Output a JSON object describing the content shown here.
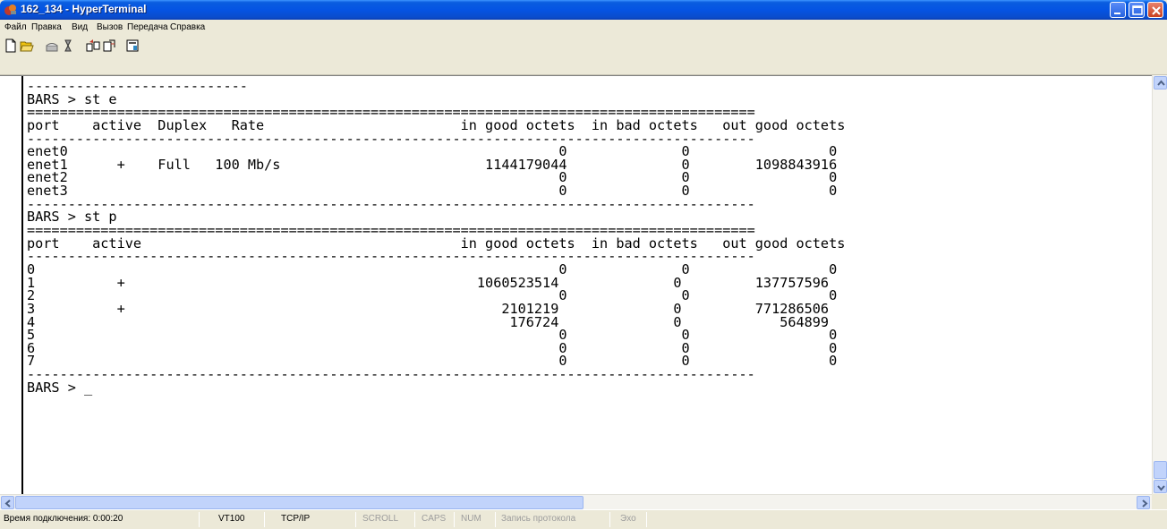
{
  "window": {
    "title": "162_134 - HyperTerminal",
    "colors": {
      "titlebar": "#0554e3",
      "close": "#c8401f"
    }
  },
  "menu": {
    "items": [
      "Файл",
      "Правка",
      "Вид",
      "Вызов",
      "Передача",
      "Справка"
    ]
  },
  "toolbar": {
    "icons": [
      "new-icon",
      "open-icon",
      "call-icon",
      "disconnect-icon",
      "send-icon",
      "receive-icon",
      "properties-icon"
    ]
  },
  "terminal": {
    "lines": [
      "---------------------------",
      "BARS > st e",
      "=========================================================================================",
      "port    active  Duplex   Rate                        in good octets  in bad octets   out good octets",
      "-----------------------------------------------------------------------------------------",
      "enet0                                                            0              0                 0",
      "enet1      +    Full   100 Mb/s                         1144179044              0        1098843916",
      "enet2                                                            0              0                 0",
      "enet3                                                            0              0                 0",
      "-----------------------------------------------------------------------------------------",
      "BARS > st p",
      "=========================================================================================",
      "port    active                                       in good octets  in bad octets   out good octets",
      "-----------------------------------------------------------------------------------------",
      "0                                                                0              0                 0",
      "1          +                                           1060523514              0         137757596",
      "2                                                                0              0                 0",
      "3          +                                              2101219              0         771286506",
      "4                                                          176724              0            564899",
      "5                                                                0              0                 0",
      "6                                                                0              0                 0",
      "7                                                                0              0                 0",
      "-----------------------------------------------------------------------------------------",
      "BARS > _"
    ]
  },
  "status": {
    "connection_time": "Время подключения: 0:00:20",
    "emulation": "VT100",
    "protocol": "TCP/IP",
    "scroll": "SCROLL",
    "caps": "CAPS",
    "num": "NUM",
    "capture": "Запись протокола",
    "echo": "Эхо"
  }
}
